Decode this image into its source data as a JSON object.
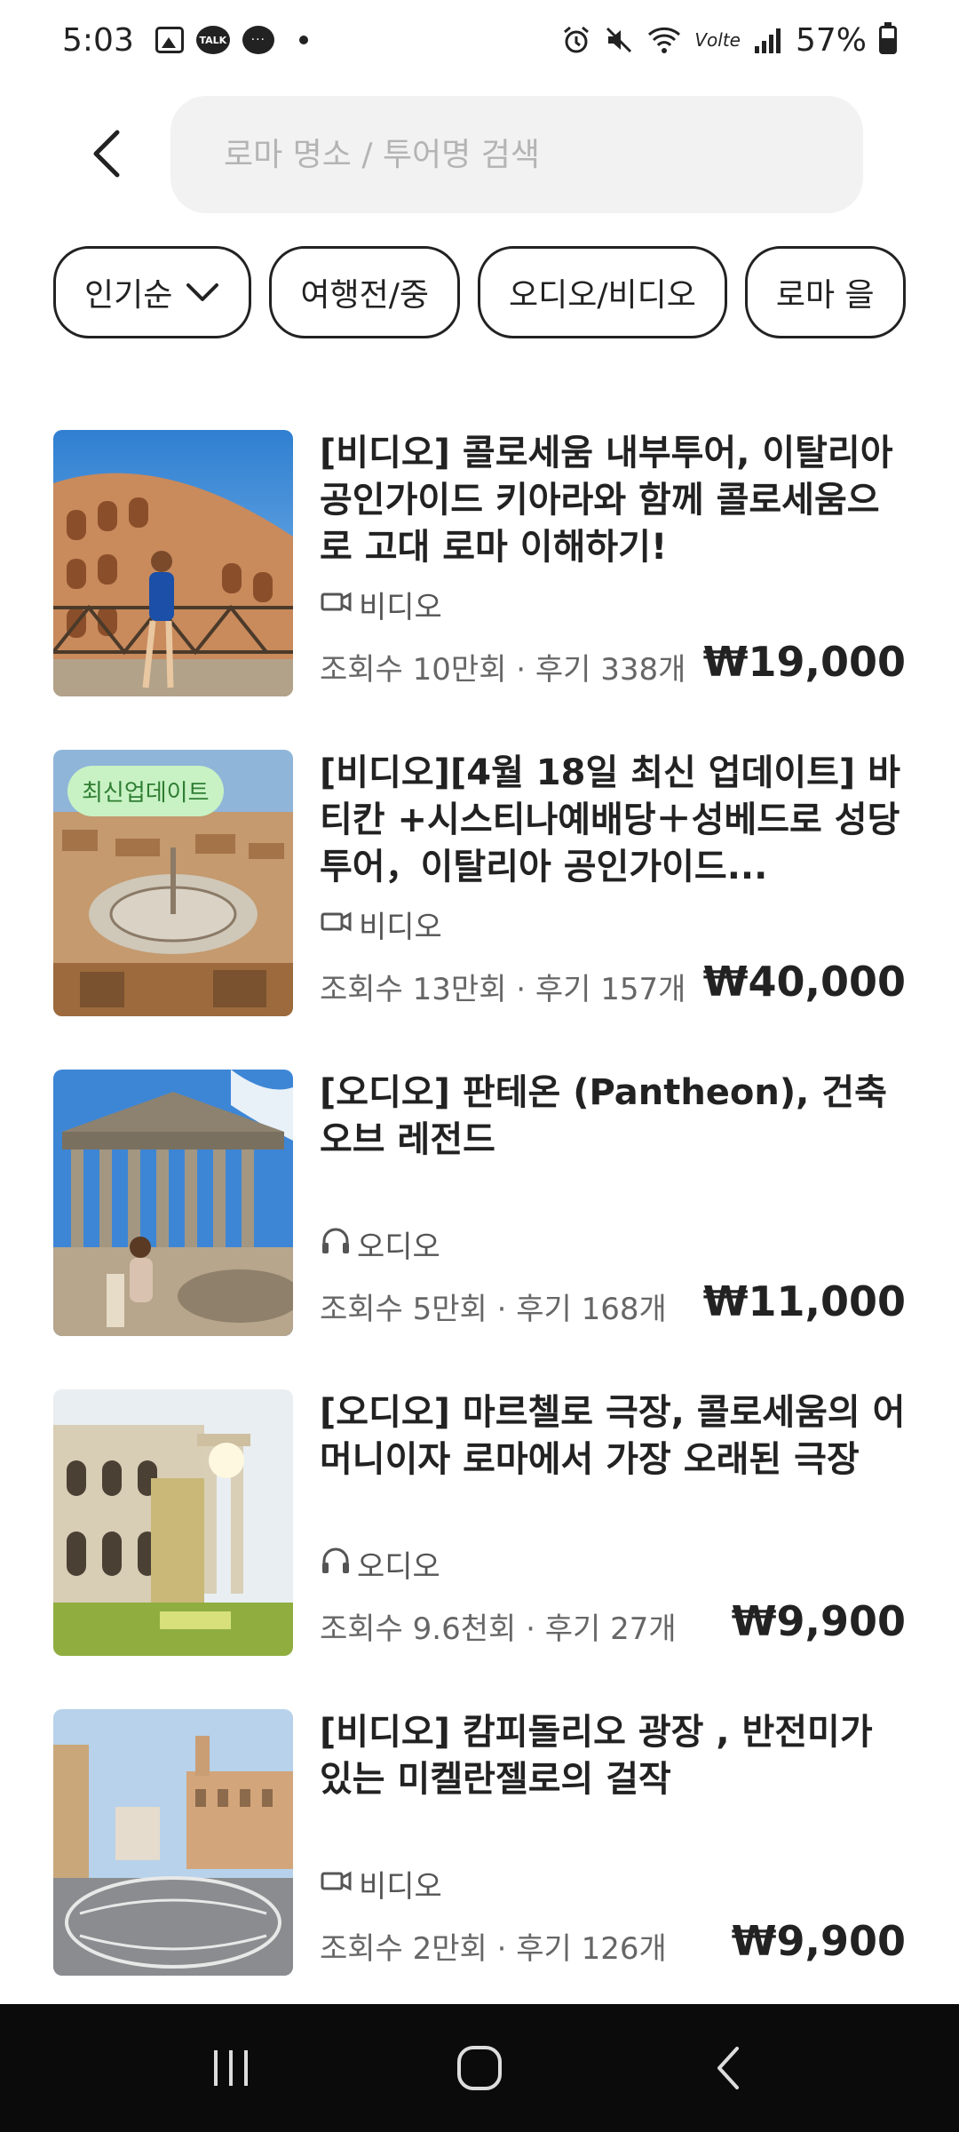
{
  "status_bar": {
    "time": "5:03",
    "talk_label": "TALK",
    "msg_label": "···",
    "volte": "Vᴏlte",
    "battery": "57%"
  },
  "search": {
    "placeholder": "로마 명소 / 투어명 검색",
    "value": ""
  },
  "filters": [
    {
      "label": "인기순",
      "has_dropdown": true
    },
    {
      "label": "여행전/중"
    },
    {
      "label": "오디오/비디오"
    },
    {
      "label": "로마 을"
    }
  ],
  "items": [
    {
      "title": "[비디오] 콜로세움 내부투어, 이탈리아 공인가이드 키아라와 함께 콜로세움으로 고대 로마 이해하기!",
      "media_type": "비디오",
      "media_icon": "video-camera-icon",
      "meta": "조회수 10만회 · 후기 338개",
      "price": "₩19,000",
      "thumb": "colosseum"
    },
    {
      "badge": "최신업데이트",
      "title": "[비디오][4월 18일 최신 업데이트] 바티칸 +시스티나예배당＋성베드로 성당투어，이탈리아 공인가이드...",
      "media_type": "비디오",
      "media_icon": "video-camera-icon",
      "meta": "조회수 13만회 · 후기 157개",
      "price": "₩40,000",
      "thumb": "vatican"
    },
    {
      "title": "[오디오] 판테온 (Pantheon), 건축 오브 레전드",
      "media_type": "오디오",
      "media_icon": "headphones-icon",
      "meta": "조회수 5만회 · 후기 168개",
      "price": "₩11,000",
      "thumb": "pantheon"
    },
    {
      "title": "[오디오] 마르첼로 극장, 콜로세움의 어머니이자 로마에서 가장 오래된 극장",
      "media_type": "오디오",
      "media_icon": "headphones-icon",
      "meta": "조회수 9.6천회 · 후기 27개",
      "price": "₩9,900",
      "thumb": "marcello"
    },
    {
      "title": "[비디오] 캄피돌리오 광장 , 반전미가 있는 미켈란젤로의 걸작",
      "media_type": "비디오",
      "media_icon": "video-camera-icon",
      "meta": "조회수 2만회 · 후기 126개",
      "price": "₩9,900",
      "thumb": "campidoglio"
    }
  ],
  "colors": {
    "badge_bg": "#c8f2c4",
    "badge_text": "#2f7d32",
    "search_bg": "#f2f2f2",
    "navbar_bg": "#0b0b0b"
  },
  "nav": [
    "recent-apps-icon",
    "home-icon",
    "back-icon"
  ]
}
